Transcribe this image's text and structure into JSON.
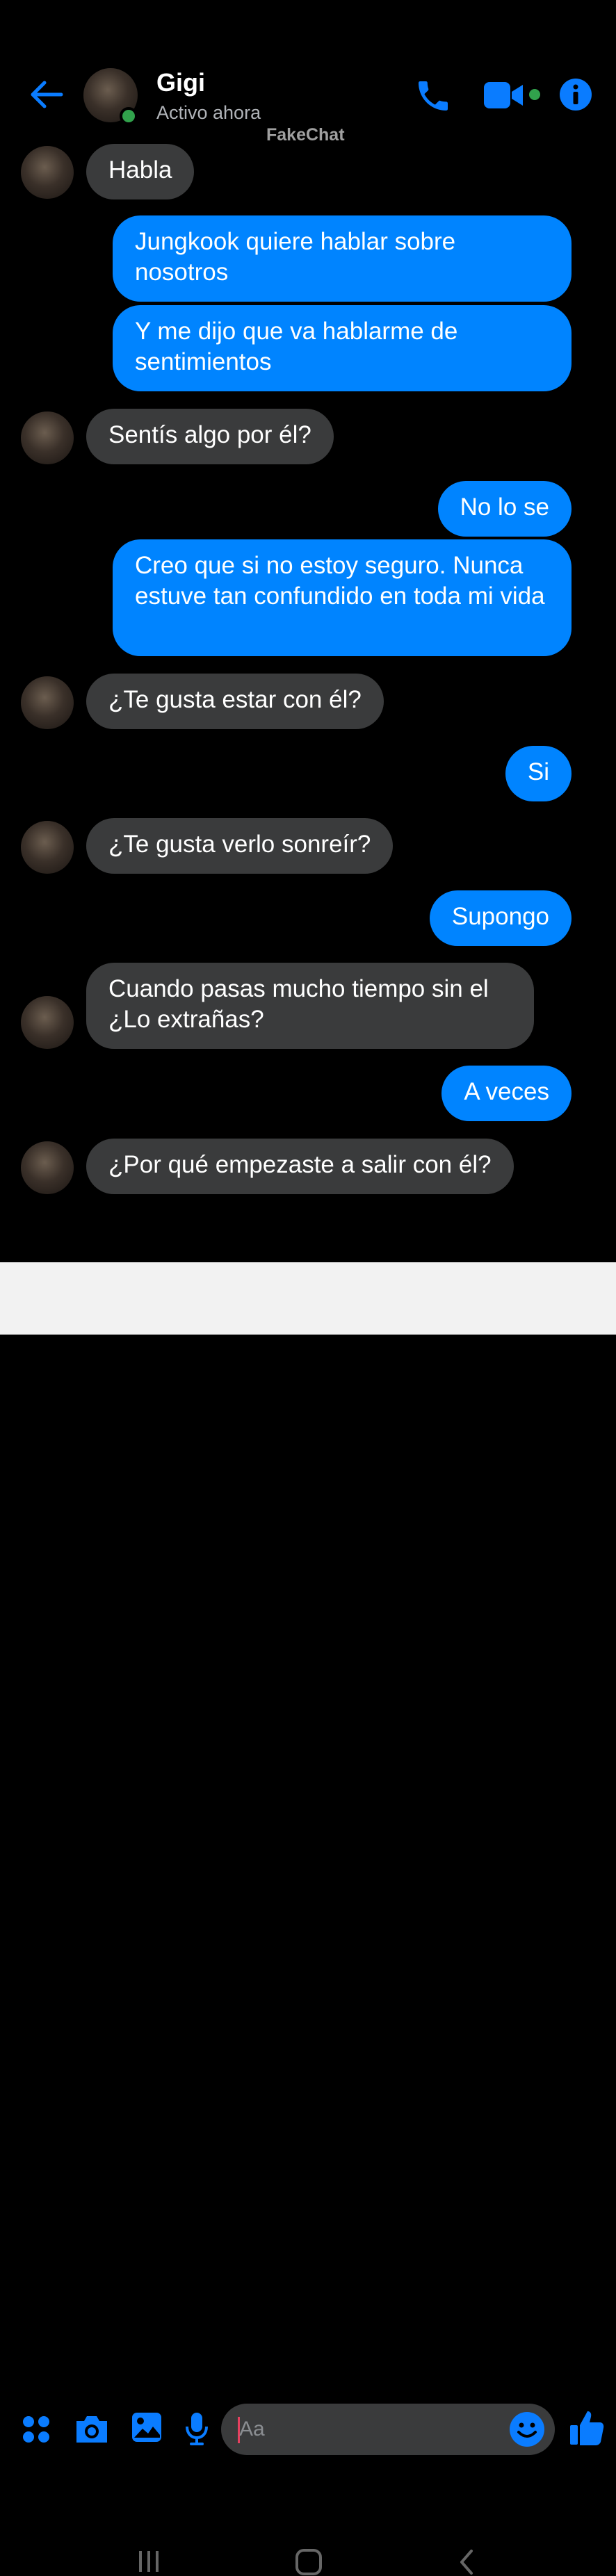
{
  "header": {
    "contact_name": "Gigi",
    "status": "Activo ahora",
    "watermark": "FakeChat"
  },
  "colors": {
    "accent": "#0084ff",
    "incoming_bubble": "#3a3b3c",
    "online": "#31a24c",
    "background": "#000000"
  },
  "icons": {
    "back": "arrow-left-icon",
    "call": "phone-icon",
    "video": "video-camera-icon",
    "info": "info-icon",
    "apps": "apps-grid-icon",
    "camera": "camera-icon",
    "gallery": "image-icon",
    "mic": "microphone-icon",
    "emoji": "emoji-icon",
    "like": "thumbs-up-icon"
  },
  "messages": [
    {
      "from": "them",
      "text": "Habla"
    },
    {
      "from": "me",
      "text": "Jungkook quiere hablar sobre nosotros"
    },
    {
      "from": "me",
      "text": "Y me dijo que va hablarme de sentimientos"
    },
    {
      "from": "them",
      "text": "Sentís algo por él?"
    },
    {
      "from": "me",
      "text": "No lo se"
    },
    {
      "from": "me",
      "text": "Creo que si no estoy seguro. Nunca estuve tan confundido en toda mi vida"
    },
    {
      "from": "them",
      "text": "¿Te gusta estar con él?"
    },
    {
      "from": "me",
      "text": "Si"
    },
    {
      "from": "them",
      "text": "¿Te gusta verlo sonreír?"
    },
    {
      "from": "me",
      "text": "Supongo"
    },
    {
      "from": "them",
      "text": "Cuando pasas mucho tiempo sin el ¿Lo extrañas?"
    },
    {
      "from": "me",
      "text": "A veces"
    },
    {
      "from": "them",
      "text": "¿Por qué empezaste a salir con él?"
    }
  ],
  "composer": {
    "placeholder": "Aa"
  }
}
